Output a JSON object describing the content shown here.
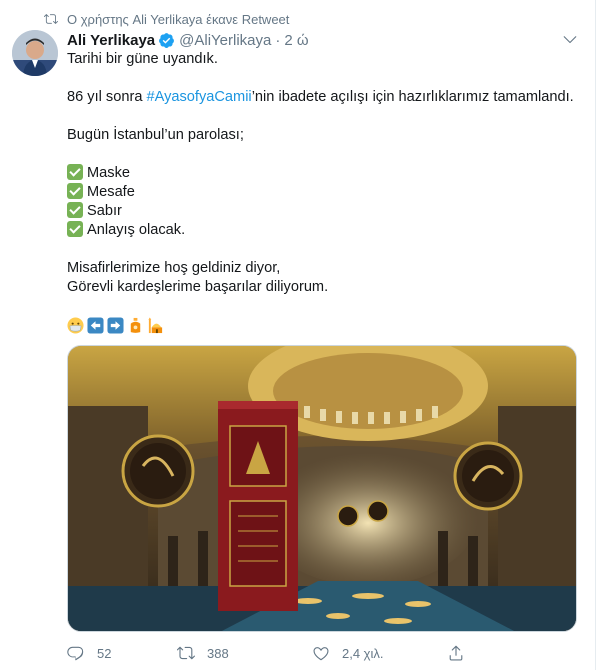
{
  "retweet": {
    "text": "Ο χρήστης Ali Yerlikaya έκανε Retweet",
    "icon": "retweet-icon"
  },
  "author": {
    "name": "Ali Yerlikaya",
    "handle": "@AliYerlikaya",
    "separator": "·",
    "time": "2 ώ",
    "verified_color": "#1da1f2"
  },
  "tweet": {
    "line1": "Tarihi bir güne uyandık.",
    "line2_prefix": "86 yıl sonra ",
    "line2_hashtag": "#AyasofyaCamii",
    "line2_suffix": "’nin ibadete açılışı için hazırlıklarımız tamamlandı.",
    "line3": "Bugün İstanbul’un parolası;",
    "checklist": [
      "Maske",
      "Mesafe",
      "Sabır",
      "Anlayış olacak."
    ],
    "line4": "Misafirlerimize hoş geldiniz diyor,",
    "line5": "Görevli kardeşlerime başarılar diliyorum.",
    "emojis": [
      "mask-face-icon",
      "left-arrow-icon",
      "right-arrow-icon",
      "sanitizer-icon",
      "mosque-icon"
    ]
  },
  "actions": {
    "replies": "52",
    "retweets": "388",
    "likes": "2,4 χιλ."
  },
  "colors": {
    "link": "#1b95e0",
    "muted": "#657786",
    "check": "#77b255"
  }
}
